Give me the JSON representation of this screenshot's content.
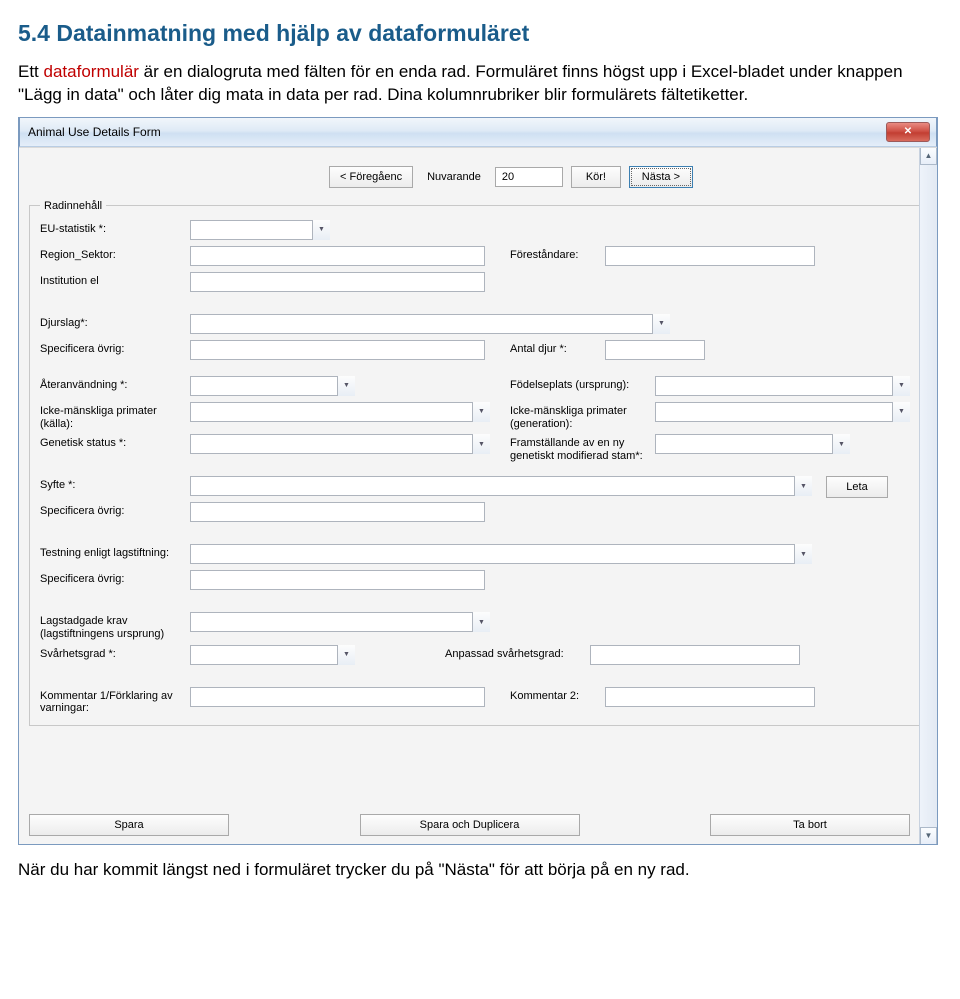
{
  "doc": {
    "heading": "5.4 Datainmatning med hjälp av dataformuläret",
    "para1_a": "Ett ",
    "para1_hl": "dataformulär",
    "para1_b": " är en dialogruta med fälten för en enda rad. Formuläret finns högst upp i Excel-bladet under knappen \"Lägg in data\" och låter dig mata in data per rad. Dina kolumnrubriker blir formulärets fältetiketter.",
    "footer": "När du har kommit längst ned i formuläret trycker du på \"Nästa\" för att börja på en ny rad."
  },
  "win": {
    "title": "Animal Use Details Form",
    "nav": {
      "prev": "< Föregåenc",
      "current_label": "Nuvarande",
      "record": "20",
      "go": "Kör!",
      "next": "Nästa >"
    },
    "group_legend": "Radinnehåll",
    "labels": {
      "eu": "EU-statistik *:",
      "region": "Region_Sektor:",
      "forest": "Föreståndare:",
      "inst": "Institution el",
      "djurslag": "Djurslag*:",
      "spec1": "Specificera övrig:",
      "antal": "Antal djur *:",
      "ater": "Återanvändning *:",
      "fodelse": "Födelseplats (ursprung):",
      "primkalla": "Icke-mänskliga primater (källa):",
      "primgen": "Icke-mänskliga primater (generation):",
      "genetisk": "Genetisk status *:",
      "framst": "Framställande av en ny genetiskt modifierad stam*:",
      "syfte": "Syfte *:",
      "leta": "Leta",
      "spec2": "Specificera övrig:",
      "testning": "Testning enligt lagstiftning:",
      "spec3": "Specificera övrig:",
      "lagkrav": "Lagstadgade krav (lagstiftningens ursprung)",
      "svar": "Svårhetsgrad *:",
      "anpsvar": "Anpassad svårhetsgrad:",
      "komm1": "Kommentar 1/Förklaring av varningar:",
      "komm2": "Kommentar 2:"
    },
    "footer": {
      "save": "Spara",
      "savedup": "Spara och Duplicera",
      "remove": "Ta bort"
    }
  }
}
